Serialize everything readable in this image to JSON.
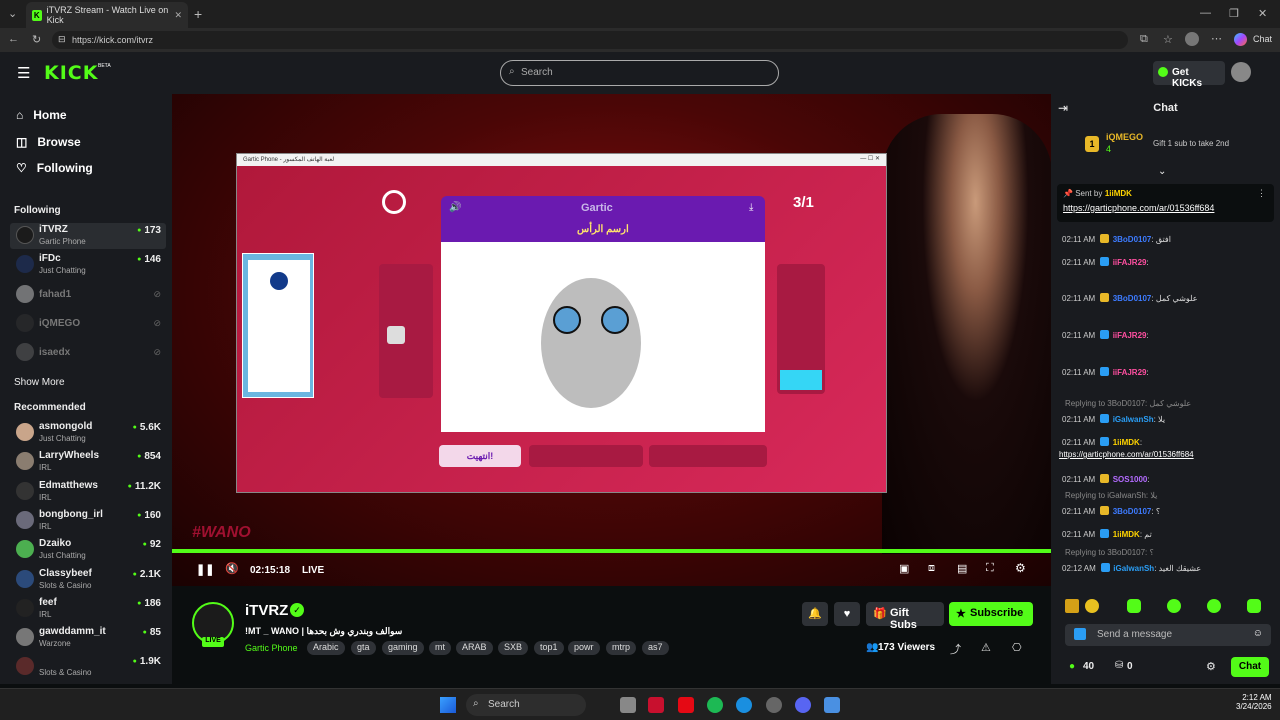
{
  "browser": {
    "tab_title": "iTVRZ Stream - Watch Live on Kick",
    "url": "https://kick.com/itvrz",
    "chat_label": "Chat"
  },
  "header": {
    "logo": "KICK",
    "logo_badge": "BETA",
    "search_placeholder": "Search",
    "get_kicks": "Get KICKs"
  },
  "sidebar": {
    "nav": [
      {
        "label": "Home",
        "icon": "home-icon"
      },
      {
        "label": "Browse",
        "icon": "compass-icon"
      },
      {
        "label": "Following",
        "icon": "heart-icon"
      }
    ],
    "following_title": "Following",
    "following": [
      {
        "name": "iTVRZ",
        "category": "Gartic Phone",
        "viewers": "173",
        "live": true
      },
      {
        "name": "iFDc",
        "category": "Just Chatting",
        "viewers": "146",
        "live": true
      },
      {
        "name": "fahad1",
        "live": false
      },
      {
        "name": "iQMEGO",
        "live": false
      },
      {
        "name": "isaedx",
        "live": false
      }
    ],
    "show_more": "Show More",
    "recommended_title": "Recommended",
    "recommended": [
      {
        "name": "asmongold",
        "category": "Just Chatting",
        "viewers": "5.6K"
      },
      {
        "name": "LarryWheels",
        "category": "IRL",
        "viewers": "854"
      },
      {
        "name": "Edmatthews",
        "category": "IRL",
        "viewers": "11.2K"
      },
      {
        "name": "bongbong_irl",
        "category": "IRL",
        "viewers": "160"
      },
      {
        "name": "Dzaiko",
        "category": "Just Chatting",
        "viewers": "92"
      },
      {
        "name": "Classybeef",
        "category": "Slots & Casino",
        "viewers": "2.1K"
      },
      {
        "name": "feef",
        "category": "IRL",
        "viewers": "186"
      },
      {
        "name": "gawddamm_it",
        "category": "Warzone",
        "viewers": "85"
      },
      {
        "name": "",
        "category": "Slots & Casino",
        "viewers": "1.9K"
      }
    ]
  },
  "player": {
    "game_window_title": "Gartic Phone - لعبة الهاتف المكسور",
    "game_logo": "Gartic",
    "prompt": "ارسم الرأس",
    "round": "3/1",
    "done_button": "انتهيت!",
    "time": "02:15:18",
    "live_label": "LIVE",
    "overlay_text": "#WANO"
  },
  "stream_info": {
    "channel": "iTVRZ",
    "live_badge": "LIVE",
    "title": "!MT _ WANO | سوالف وبندري وش بحدها",
    "category": "Gartic Phone",
    "tags": [
      "Arabic",
      "gta",
      "gaming",
      "mt",
      "ARAB",
      "SXB",
      "top1",
      "powr",
      "mtrp",
      "as7"
    ],
    "gift_subs": "Gift Subs",
    "subscribe": "Subscribe",
    "viewers": "173 Viewers"
  },
  "chat": {
    "title": "Chat",
    "leader_name": "iQMEGO",
    "leader_rank": "1",
    "leader_count": "4",
    "leader_gift_text": "Gift 1 sub to take 2nd",
    "pinned_by_label": "Sent by",
    "pinned_by": "1iiMDK",
    "pinned_link": "https://garticphone.com/ar/01536ff684",
    "messages": [
      {
        "time": "02:11 AM",
        "user": "3BoD0107",
        "color": "#3d7bff",
        "text": "افتق"
      },
      {
        "time": "02:11 AM",
        "user": "iiFAJR29",
        "color": "#ff4fa0",
        "text": ""
      },
      {
        "time": "02:11 AM",
        "user": "3BoD0107",
        "color": "#3d7bff",
        "text": "علوشي كمل"
      },
      {
        "time": "02:11 AM",
        "user": "iiFAJR29",
        "color": "#ff4fa0",
        "text": ""
      },
      {
        "time": "02:11 AM",
        "user": "iiFAJR29",
        "color": "#ff4fa0",
        "text": ""
      },
      {
        "time": "02:11 AM",
        "user": "iGalwanSh",
        "color": "#2a9df4",
        "text": "يلا",
        "reply": "Replying to 3BoD0107: علوشي كمل"
      },
      {
        "time": "02:11 AM",
        "user": "1iiMDK",
        "color": "#ffd400",
        "text": "https://garticphone.com/ar/01536ff684"
      },
      {
        "time": "02:11 AM",
        "user": "SOS1000",
        "color": "#b36bff",
        "text": ""
      },
      {
        "time": "02:11 AM",
        "user": "3BoD0107",
        "color": "#3d7bff",
        "text": "؟",
        "reply": "Replying to iGalwanSh: يلا"
      },
      {
        "time": "02:11 AM",
        "user": "1iiMDK",
        "color": "#ffd400",
        "text": "تم"
      },
      {
        "time": "02:12 AM",
        "user": "iGalwanSh",
        "color": "#2a9df4",
        "text": "عشيقك الغيد",
        "reply": "Replying to 3BoD0107: ؟"
      }
    ],
    "input_placeholder": "Send a message",
    "kicks_count": "40",
    "points_count": "0",
    "send_button": "Chat"
  },
  "taskbar": {
    "search": "Search",
    "time": "2:12 AM",
    "date": "3/24/2026"
  }
}
